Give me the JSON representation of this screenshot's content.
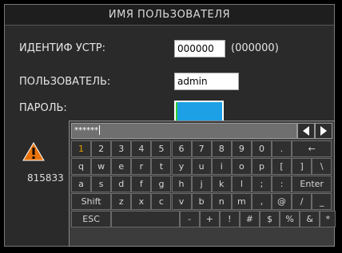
{
  "dialog": {
    "title": "ИМЯ ПОЛЬЗОВАТЕЛЯ",
    "device_id_label": "ИДЕНТИФ УСТР:",
    "device_id_value": "000000",
    "device_id_hint": "(000000)",
    "user_label": "ПОЛЬЗОВАТЕЛЬ:",
    "user_value": "admin",
    "password_label": "ПАРОЛЬ:",
    "code_text": "815833"
  },
  "keyboard": {
    "input_value": "******",
    "row1": [
      "1",
      "2",
      "3",
      "4",
      "5",
      "6",
      "7",
      "8",
      "9",
      "0",
      ".",
      "←"
    ],
    "row2": [
      "q",
      "w",
      "e",
      "r",
      "t",
      "y",
      "u",
      "i",
      "o",
      "p",
      "[",
      "]",
      "\\"
    ],
    "row3": [
      "a",
      "s",
      "d",
      "f",
      "g",
      "h",
      "j",
      "k",
      "l",
      ";",
      ":",
      "Enter"
    ],
    "row4": [
      "Shift",
      "z",
      "x",
      "c",
      "v",
      "b",
      "n",
      "m",
      ",",
      "@",
      "/",
      "_"
    ],
    "row5": [
      "ESC",
      "",
      "-",
      "+",
      "!",
      "#",
      "$",
      "%",
      "&",
      "*"
    ]
  },
  "colors": {
    "active_key": "#e2a200",
    "password_fill": "#1da0e6",
    "warning": "#e8730c"
  }
}
